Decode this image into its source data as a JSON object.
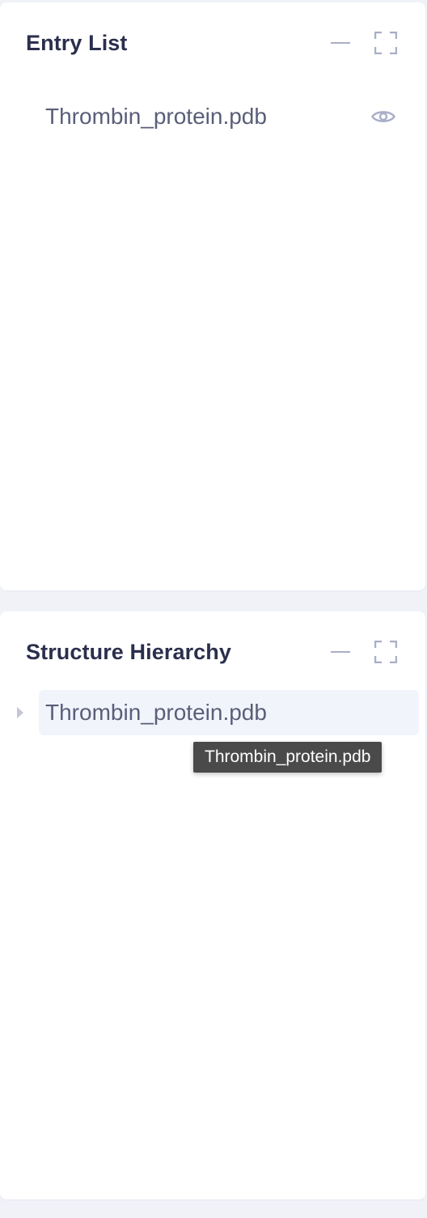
{
  "entry_panel": {
    "title": "Entry List",
    "minimize_icon": "minus-icon",
    "expand_icon": "fullscreen-icon",
    "items": [
      {
        "label": "Thrombin_protein.pdb",
        "visibility_icon": "eye-icon"
      }
    ]
  },
  "structure_panel": {
    "title": "Structure Hierarchy",
    "minimize_icon": "minus-icon",
    "expand_icon": "fullscreen-icon",
    "tree": [
      {
        "label": "Thrombin_protein.pdb",
        "expand_icon": "caret-right-icon"
      }
    ],
    "tooltip": "Thrombin_protein.pdb"
  },
  "colors": {
    "page_background": "#f0f2f8",
    "panel_background": "#ffffff",
    "title_text": "#2b2f4d",
    "item_text": "#5a5e78",
    "icon": "#a9aec6",
    "row_highlight": "#f2f4fc",
    "tooltip_background": "#4a4a4a"
  }
}
